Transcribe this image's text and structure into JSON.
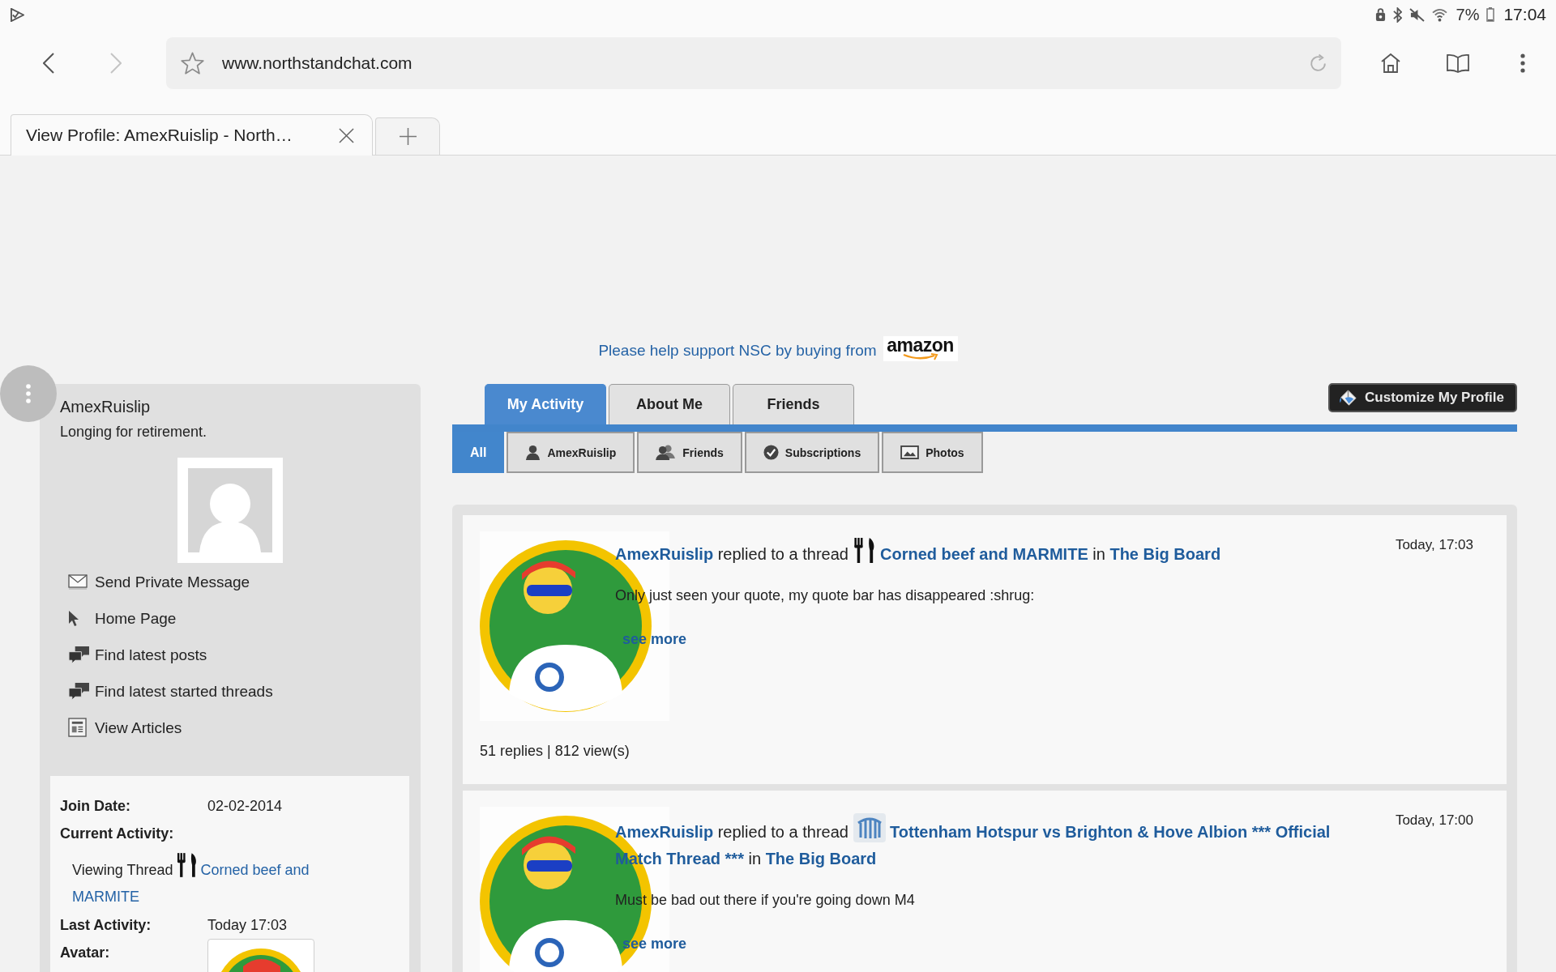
{
  "status_bar": {
    "battery": "7%",
    "time": "17:04"
  },
  "browser": {
    "back": {
      "disabled": false
    },
    "forward": {
      "disabled": true
    },
    "url": "www.northstandchat.com",
    "tabs": [
      {
        "title": "View Profile: AmexRuislip - North…",
        "selected": true
      }
    ]
  },
  "banner": {
    "text": "Please help support NSC by buying from",
    "logo": "amazon"
  },
  "profile": {
    "username": "AmexRuislip",
    "status": "Longing for retirement.",
    "links": [
      "Send Private Message",
      "Home Page",
      "Find latest posts",
      "Find latest started threads",
      "View Articles"
    ],
    "details": {
      "join_date": {
        "label": "Join Date:",
        "value": "02-02-2014"
      },
      "current_activity": {
        "label": "Current Activity:",
        "prefix": "Viewing Thread",
        "thread": [
          "Corned beef and",
          "MARMITE"
        ]
      },
      "last_activity": {
        "label": "Last Activity:",
        "value": "Today 17:03"
      },
      "avatar": {
        "label": "Avatar:"
      }
    }
  },
  "tabs": [
    {
      "label": "My Activity",
      "selected": true
    },
    {
      "label": "About Me",
      "selected": false
    },
    {
      "label": "Friends",
      "selected": false
    }
  ],
  "customize_button": "Customize My Profile",
  "filters": [
    {
      "label": "All",
      "selected": true
    },
    {
      "label": "AmexRuislip",
      "selected": false
    },
    {
      "label": "Friends",
      "selected": false
    },
    {
      "label": "Subscriptions",
      "selected": false
    },
    {
      "label": "Photos",
      "selected": false
    }
  ],
  "activity": [
    {
      "user": "AmexRuislip",
      "action": "replied to a thread",
      "thread": [
        "Corned beef and MARMITE"
      ],
      "preposition": "in",
      "forum": "The Big Board",
      "time": "Today, 17:03",
      "excerpt": "Only just seen your quote, my quote bar has disappeared :shrug:",
      "see_more": "see more",
      "stats": "51 replies | 812 view(s)"
    },
    {
      "user": "AmexRuislip",
      "action": "replied to a thread",
      "thread": [
        "Tottenham Hotspur vs Brighton & Hove Albion *** Official",
        "Match Thread ***"
      ],
      "preposition": "in",
      "forum": "The Big Board",
      "time": "Today, 17:00",
      "excerpt": "Must be bad out there if you're going down M4",
      "see_more": "see more"
    }
  ]
}
